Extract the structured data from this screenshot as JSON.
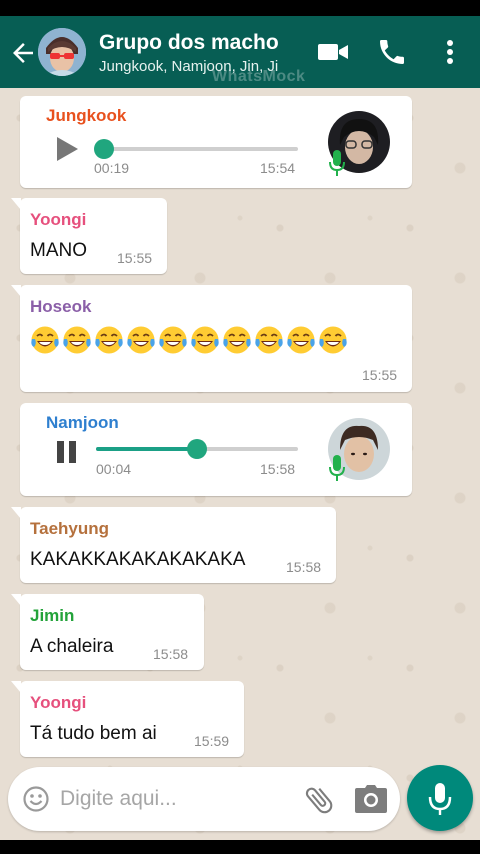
{
  "header": {
    "title": "Grupo dos macho",
    "subtitle": "Jungkook, Namjoon, Jin, Ji",
    "watermark": "WhatsMock",
    "back_icon": "arrow-left-icon",
    "video_icon": "video-camera-icon",
    "call_icon": "phone-icon",
    "menu_icon": "more-vertical-icon"
  },
  "messages": [
    {
      "type": "voice",
      "sender": "Jungkook",
      "sender_color": "#e8511e",
      "duration": "00:19",
      "time": "15:54",
      "state": "paused",
      "progress": 0.0
    },
    {
      "type": "text",
      "sender": "Yoongi",
      "sender_color": "#e6507d",
      "text": "MANO",
      "time": "15:55"
    },
    {
      "type": "emoji",
      "sender": "Hoseok",
      "sender_color": "#8b5fa8",
      "emoji": "😂😂😂😂😂😂😂😂😂😂",
      "emoji_count": 10,
      "time": "15:55"
    },
    {
      "type": "voice",
      "sender": "Namjoon",
      "sender_color": "#2e7fcf",
      "duration": "00:04",
      "time": "15:58",
      "state": "playing",
      "progress": 0.5
    },
    {
      "type": "text",
      "sender": "Taehyung",
      "sender_color": "#b5713d",
      "text": "KAKAKKAKAKAKAKAKA",
      "time": "15:58"
    },
    {
      "type": "text",
      "sender": "Jimin",
      "sender_color": "#23a33a",
      "text": "A chaleira",
      "time": "15:58"
    },
    {
      "type": "text",
      "sender": "Yoongi",
      "sender_color": "#e6507d",
      "text": "Tá tudo bem ai",
      "time": "15:59"
    }
  ],
  "input": {
    "placeholder": "Digite aqui...",
    "emoji_icon": "smiley-icon",
    "attach_icon": "paperclip-icon",
    "camera_icon": "camera-icon",
    "mic_icon": "microphone-icon"
  },
  "colors": {
    "header_bg": "#075e54",
    "accent": "#00897b",
    "chat_bg": "#e7ded3"
  }
}
